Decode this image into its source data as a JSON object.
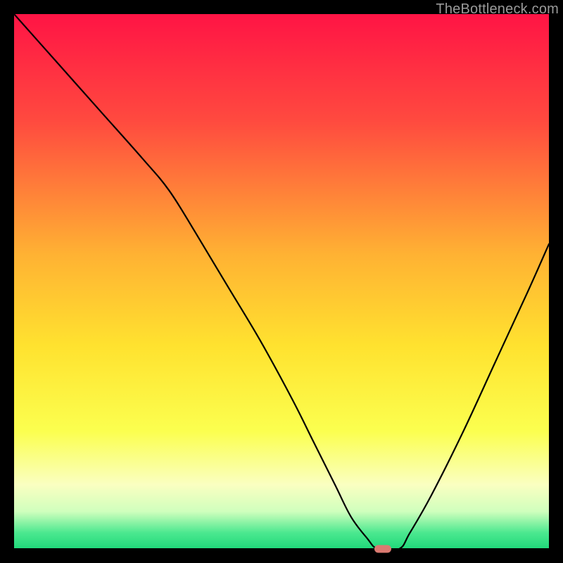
{
  "watermark": "TheBottleneck.com",
  "chart_data": {
    "type": "line",
    "title": "",
    "xlabel": "",
    "ylabel": "",
    "xlim": [
      0,
      100
    ],
    "ylim": [
      0,
      100
    ],
    "gradient_stops": [
      {
        "offset": 0,
        "color": "#ff1445"
      },
      {
        "offset": 20,
        "color": "#ff4a3f"
      },
      {
        "offset": 45,
        "color": "#ffb233"
      },
      {
        "offset": 62,
        "color": "#ffe22f"
      },
      {
        "offset": 78,
        "color": "#fbff4f"
      },
      {
        "offset": 88,
        "color": "#faffc1"
      },
      {
        "offset": 93,
        "color": "#d0ffbd"
      },
      {
        "offset": 97,
        "color": "#4be88f"
      },
      {
        "offset": 100,
        "color": "#1fd87a"
      }
    ],
    "green_band": {
      "from_y": 96,
      "to_y": 100
    },
    "series": [
      {
        "name": "curve",
        "x": [
          0,
          8,
          16,
          24,
          29,
          34,
          40,
          46,
          52,
          56,
          60,
          63,
          66,
          68,
          72,
          74,
          78,
          84,
          90,
          96,
          100
        ],
        "y": [
          100,
          91,
          82,
          73,
          67,
          59,
          49,
          39,
          28,
          20,
          12,
          6,
          2,
          0,
          0,
          3,
          10,
          22,
          35,
          48,
          57
        ]
      }
    ],
    "marker": {
      "x": 69,
      "y": 0,
      "color": "#db7a71"
    }
  }
}
